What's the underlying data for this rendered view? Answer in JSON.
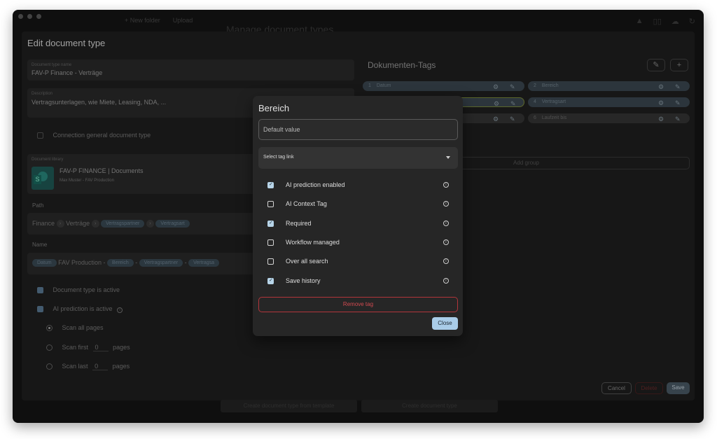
{
  "background": {
    "toolbar": [
      "+ New folder",
      "Upload"
    ],
    "title": "Manage document types",
    "bottom_buttons": [
      "Create document type from template",
      "Create document type"
    ]
  },
  "editor": {
    "title": "Edit document type",
    "name_label": "Document type name",
    "name_value": "FAV-P Finance - Verträge",
    "desc_label": "Description",
    "desc_value": "Vertragsunterlagen, wie Miete, Leasing, NDA, ...",
    "connection_label": "Connection general document type",
    "library_label": "Document library",
    "library_name": "FAV-P FINANCE | Documents",
    "library_sub": "Max Muster - FAV Production",
    "path_label": "Path",
    "path": [
      "Finance",
      "Verträge",
      "Vertragspartner",
      "Vertragsart"
    ],
    "name_section_label": "Name",
    "name_parts": [
      "Datum",
      "FAV Production -",
      "Bereich",
      "-",
      "Vertragspartner",
      "-",
      "Vertragsa"
    ],
    "active_label": "Document type is active",
    "ai_label": "AI prediction is active",
    "scan_all": "Scan all pages",
    "scan_first": "Scan first",
    "scan_last": "Scan last",
    "scan_first_value": "0",
    "scan_last_value": "0",
    "pages": "pages"
  },
  "tags": {
    "heading": "Dokumenten-Tags",
    "items": [
      {
        "num": "1",
        "label": "Datum"
      },
      {
        "num": "2",
        "label": "Bereich"
      },
      {
        "num": "4",
        "label": "Vertragsart"
      },
      {
        "num": "6",
        "label": "Laufzeit bis"
      }
    ],
    "add_group": "Add group"
  },
  "footer": {
    "cancel": "Cancel",
    "delete": "Delete",
    "save": "Save"
  },
  "modal": {
    "title": "Bereich",
    "default_placeholder": "Default value",
    "select_label": "Select tag link",
    "options": [
      {
        "label": "AI prediction enabled",
        "checked": true
      },
      {
        "label": "AI Context Tag",
        "checked": false
      },
      {
        "label": "Required",
        "checked": true
      },
      {
        "label": "Workflow managed",
        "checked": false
      },
      {
        "label": "Over all search",
        "checked": false
      },
      {
        "label": "Save history",
        "checked": true
      }
    ],
    "remove_label": "Remove tag",
    "close_label": "Close"
  }
}
